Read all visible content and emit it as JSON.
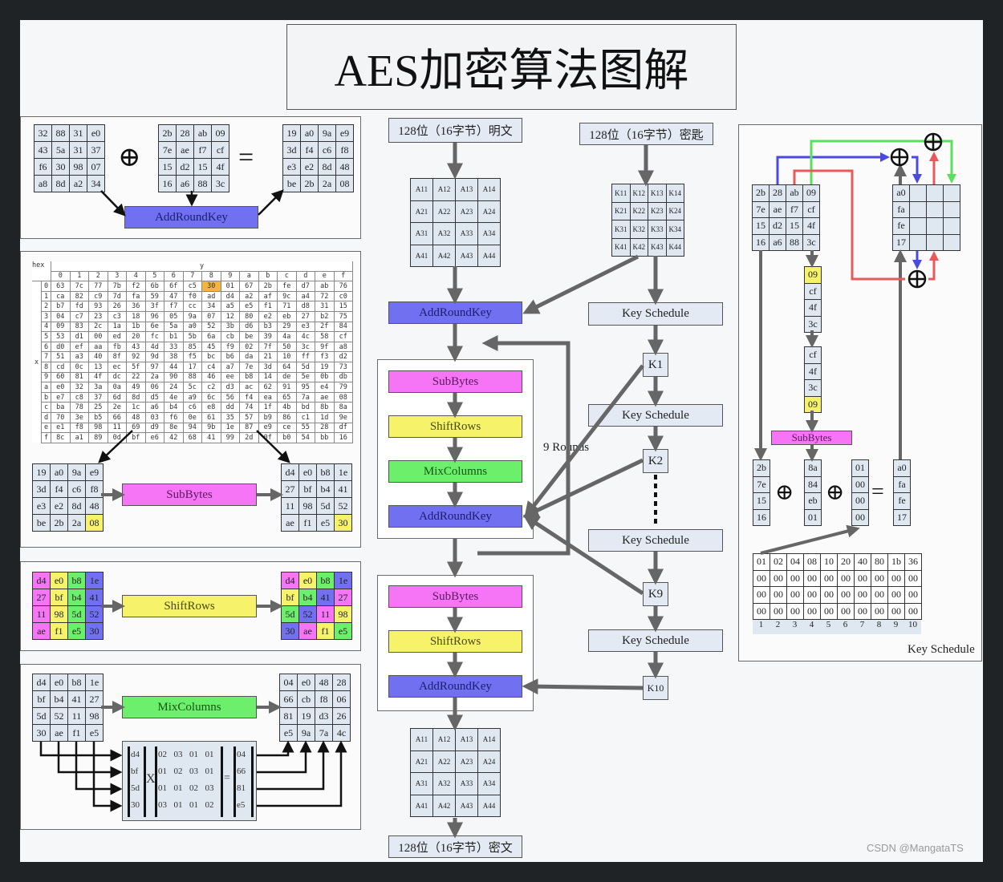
{
  "title": "AES加密算法图解",
  "symbols": {
    "xor": "⊕",
    "equals": "="
  },
  "add_round_key_example": {
    "label": "AddRoundKey",
    "state": [
      [
        "32",
        "88",
        "31",
        "e0"
      ],
      [
        "43",
        "5a",
        "31",
        "37"
      ],
      [
        "f6",
        "30",
        "98",
        "07"
      ],
      [
        "a8",
        "8d",
        "a2",
        "34"
      ]
    ],
    "round_key": [
      [
        "2b",
        "28",
        "ab",
        "09"
      ],
      [
        "7e",
        "ae",
        "f7",
        "cf"
      ],
      [
        "15",
        "d2",
        "15",
        "4f"
      ],
      [
        "16",
        "a6",
        "88",
        "3c"
      ]
    ],
    "result": [
      [
        "19",
        "a0",
        "9a",
        "e9"
      ],
      [
        "3d",
        "f4",
        "c6",
        "f8"
      ],
      [
        "e3",
        "e2",
        "8d",
        "48"
      ],
      [
        "be",
        "2b",
        "2a",
        "08"
      ]
    ]
  },
  "sbox": {
    "corner": "hex",
    "x_label": "x",
    "y_label": "y",
    "col_headers": [
      "0",
      "1",
      "2",
      "3",
      "4",
      "5",
      "6",
      "7",
      "8",
      "9",
      "a",
      "b",
      "c",
      "d",
      "e",
      "f"
    ],
    "row_headers": [
      "0",
      "1",
      "2",
      "3",
      "4",
      "5",
      "6",
      "7",
      "8",
      "9",
      "a",
      "b",
      "c",
      "d",
      "e",
      "f"
    ],
    "highlight_color": "#f2b640",
    "highlight": {
      "row": "0",
      "col": "8",
      "value": "30"
    },
    "rows": [
      [
        "63",
        "7c",
        "77",
        "7b",
        "f2",
        "6b",
        "6f",
        "c5",
        "30",
        "01",
        "67",
        "2b",
        "fe",
        "d7",
        "ab",
        "76"
      ],
      [
        "ca",
        "82",
        "c9",
        "7d",
        "fa",
        "59",
        "47",
        "f0",
        "ad",
        "d4",
        "a2",
        "af",
        "9c",
        "a4",
        "72",
        "c0"
      ],
      [
        "b7",
        "fd",
        "93",
        "26",
        "36",
        "3f",
        "f7",
        "cc",
        "34",
        "a5",
        "e5",
        "f1",
        "71",
        "d8",
        "31",
        "15"
      ],
      [
        "04",
        "c7",
        "23",
        "c3",
        "18",
        "96",
        "05",
        "9a",
        "07",
        "12",
        "80",
        "e2",
        "eb",
        "27",
        "b2",
        "75"
      ],
      [
        "09",
        "83",
        "2c",
        "1a",
        "1b",
        "6e",
        "5a",
        "a0",
        "52",
        "3b",
        "d6",
        "b3",
        "29",
        "e3",
        "2f",
        "84"
      ],
      [
        "53",
        "d1",
        "00",
        "ed",
        "20",
        "fc",
        "b1",
        "5b",
        "6a",
        "cb",
        "be",
        "39",
        "4a",
        "4c",
        "58",
        "cf"
      ],
      [
        "d0",
        "ef",
        "aa",
        "fb",
        "43",
        "4d",
        "33",
        "85",
        "45",
        "f9",
        "02",
        "7f",
        "50",
        "3c",
        "9f",
        "a8"
      ],
      [
        "51",
        "a3",
        "40",
        "8f",
        "92",
        "9d",
        "38",
        "f5",
        "bc",
        "b6",
        "da",
        "21",
        "10",
        "ff",
        "f3",
        "d2"
      ],
      [
        "cd",
        "0c",
        "13",
        "ec",
        "5f",
        "97",
        "44",
        "17",
        "c4",
        "a7",
        "7e",
        "3d",
        "64",
        "5d",
        "19",
        "73"
      ],
      [
        "60",
        "81",
        "4f",
        "dc",
        "22",
        "2a",
        "90",
        "88",
        "46",
        "ee",
        "b8",
        "14",
        "de",
        "5e",
        "0b",
        "db"
      ],
      [
        "e0",
        "32",
        "3a",
        "0a",
        "49",
        "06",
        "24",
        "5c",
        "c2",
        "d3",
        "ac",
        "62",
        "91",
        "95",
        "e4",
        "79"
      ],
      [
        "e7",
        "c8",
        "37",
        "6d",
        "8d",
        "d5",
        "4e",
        "a9",
        "6c",
        "56",
        "f4",
        "ea",
        "65",
        "7a",
        "ae",
        "08"
      ],
      [
        "ba",
        "78",
        "25",
        "2e",
        "1c",
        "a6",
        "b4",
        "c6",
        "e8",
        "dd",
        "74",
        "1f",
        "4b",
        "bd",
        "8b",
        "8a"
      ],
      [
        "70",
        "3e",
        "b5",
        "66",
        "48",
        "03",
        "f6",
        "0e",
        "61",
        "35",
        "57",
        "b9",
        "86",
        "c1",
        "1d",
        "9e"
      ],
      [
        "e1",
        "f8",
        "98",
        "11",
        "69",
        "d9",
        "8e",
        "94",
        "9b",
        "1e",
        "87",
        "e9",
        "ce",
        "55",
        "28",
        "df"
      ],
      [
        "8c",
        "a1",
        "89",
        "0d",
        "bf",
        "e6",
        "42",
        "68",
        "41",
        "99",
        "2d",
        "0f",
        "b0",
        "54",
        "bb",
        "16"
      ]
    ]
  },
  "sub_bytes_example": {
    "label": "SubBytes",
    "input": [
      [
        "19",
        "a0",
        "9a",
        "e9"
      ],
      [
        "3d",
        "f4",
        "c6",
        "f8"
      ],
      [
        "e3",
        "e2",
        "8d",
        "48"
      ],
      [
        "be",
        "2b",
        "2a",
        "08"
      ]
    ],
    "output": [
      [
        "d4",
        "e0",
        "b8",
        "1e"
      ],
      [
        "27",
        "bf",
        "b4",
        "41"
      ],
      [
        "11",
        "98",
        "5d",
        "52"
      ],
      [
        "ae",
        "f1",
        "e5",
        "30"
      ]
    ],
    "highlight_color": "#f6f36a"
  },
  "shift_rows_example": {
    "label": "ShiftRows",
    "input": [
      [
        "d4",
        "e0",
        "b8",
        "1e"
      ],
      [
        "27",
        "bf",
        "b4",
        "41"
      ],
      [
        "11",
        "98",
        "5d",
        "52"
      ],
      [
        "ae",
        "f1",
        "e5",
        "30"
      ]
    ],
    "input_colors": [
      [
        "#f674f6",
        "#f6f36a",
        "#6cf06c",
        "#7070f0"
      ],
      [
        "#f674f6",
        "#f6f36a",
        "#6cf06c",
        "#7070f0"
      ],
      [
        "#f674f6",
        "#f6f36a",
        "#6cf06c",
        "#7070f0"
      ],
      [
        "#f674f6",
        "#f6f36a",
        "#6cf06c",
        "#7070f0"
      ]
    ],
    "output": [
      [
        "d4",
        "e0",
        "b8",
        "1e"
      ],
      [
        "bf",
        "b4",
        "41",
        "27"
      ],
      [
        "5d",
        "52",
        "11",
        "98"
      ],
      [
        "30",
        "ae",
        "f1",
        "e5"
      ]
    ],
    "output_colors": [
      [
        "#f674f6",
        "#f6f36a",
        "#6cf06c",
        "#7070f0"
      ],
      [
        "#f6f36a",
        "#6cf06c",
        "#7070f0",
        "#f674f6"
      ],
      [
        "#6cf06c",
        "#7070f0",
        "#f674f6",
        "#f6f36a"
      ],
      [
        "#7070f0",
        "#f674f6",
        "#f6f36a",
        "#6cf06c"
      ]
    ]
  },
  "mix_columns_example": {
    "label": "MixColumns",
    "input": [
      [
        "d4",
        "e0",
        "b8",
        "1e"
      ],
      [
        "bf",
        "b4",
        "41",
        "27"
      ],
      [
        "5d",
        "52",
        "11",
        "98"
      ],
      [
        "30",
        "ae",
        "f1",
        "e5"
      ]
    ],
    "output": [
      [
        "04",
        "e0",
        "48",
        "28"
      ],
      [
        "66",
        "cb",
        "f8",
        "06"
      ],
      [
        "81",
        "19",
        "d3",
        "26"
      ],
      [
        "e5",
        "9a",
        "7a",
        "4c"
      ]
    ],
    "column": [
      "d4",
      "bf",
      "5d",
      "30"
    ],
    "times": "X",
    "matrix": [
      [
        "02",
        "03",
        "01",
        "01"
      ],
      [
        "01",
        "02",
        "03",
        "01"
      ],
      [
        "01",
        "01",
        "02",
        "03"
      ],
      [
        "03",
        "01",
        "01",
        "02"
      ]
    ],
    "result": [
      "04",
      "66",
      "81",
      "e5"
    ]
  },
  "flow": {
    "plaintext_label": "128位（16字节）明文",
    "key_label": "128位（16字节）密匙",
    "ciphertext_label": "128位（16字节）密文",
    "state_matrix": [
      [
        "A11",
        "A12",
        "A13",
        "A14"
      ],
      [
        "A21",
        "A22",
        "A23",
        "A24"
      ],
      [
        "A31",
        "A32",
        "A33",
        "A34"
      ],
      [
        "A41",
        "A42",
        "A43",
        "A44"
      ]
    ],
    "key_matrix": [
      [
        "K11",
        "K12",
        "K13",
        "K14"
      ],
      [
        "K21",
        "K22",
        "K23",
        "K24"
      ],
      [
        "K31",
        "K32",
        "K33",
        "K34"
      ],
      [
        "K41",
        "K42",
        "K43",
        "K44"
      ]
    ],
    "initial_step": "AddRoundKey",
    "round_steps": [
      "SubBytes",
      "ShiftRows",
      "MixColumns",
      "AddRoundKey"
    ],
    "final_steps": [
      "SubBytes",
      "ShiftRows",
      "AddRoundKey"
    ],
    "loop_label": "9 Rounds",
    "key_schedule_label": "Key Schedule",
    "round_keys": [
      "K1",
      "K2",
      "K9",
      "K10"
    ]
  },
  "key_schedule_panel": {
    "caption": "Key Schedule",
    "cipher_key": [
      [
        "2b",
        "28",
        "ab",
        "09"
      ],
      [
        "7e",
        "ae",
        "f7",
        "cf"
      ],
      [
        "15",
        "d2",
        "15",
        "4f"
      ],
      [
        "16",
        "a6",
        "88",
        "3c"
      ]
    ],
    "round_key_first_column": [
      "a0",
      "fa",
      "fe",
      "17"
    ],
    "last_column": [
      "09",
      "cf",
      "4f",
      "3c"
    ],
    "rot_word": [
      "cf",
      "4f",
      "3c",
      "09"
    ],
    "rot_highlight_color": "#f6f36a",
    "sub_bytes_label": "SubBytes",
    "first_column": [
      "2b",
      "7e",
      "15",
      "16"
    ],
    "sub_word": [
      "8a",
      "84",
      "eb",
      "01"
    ],
    "rcon_column": [
      "01",
      "00",
      "00",
      "00"
    ],
    "result_column": [
      "a0",
      "fa",
      "fe",
      "17"
    ],
    "rcon_table": [
      [
        "01",
        "02",
        "04",
        "08",
        "10",
        "20",
        "40",
        "80",
        "1b",
        "36"
      ],
      [
        "00",
        "00",
        "00",
        "00",
        "00",
        "00",
        "00",
        "00",
        "00",
        "00"
      ],
      [
        "00",
        "00",
        "00",
        "00",
        "00",
        "00",
        "00",
        "00",
        "00",
        "00"
      ],
      [
        "00",
        "00",
        "00",
        "00",
        "00",
        "00",
        "00",
        "00",
        "00",
        "00"
      ]
    ],
    "rcon_indices": [
      "1",
      "2",
      "3",
      "4",
      "5",
      "6",
      "7",
      "8",
      "9",
      "10"
    ],
    "arrow_colors": {
      "blue": "#4a4ae0",
      "green": "#5ae05a",
      "red": "#e85a5a"
    }
  },
  "watermark": "CSDN @MangataTS"
}
